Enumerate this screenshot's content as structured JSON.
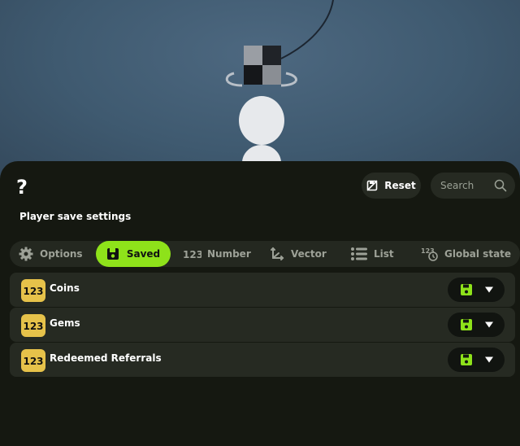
{
  "header": {
    "help_glyph": "?",
    "reset_label": "Reset",
    "search_placeholder": "Search"
  },
  "title": "Player save settings",
  "tabs": [
    {
      "label": "Options",
      "icon": "gear-icon",
      "active": false
    },
    {
      "label": "Saved",
      "icon": "save-icon",
      "active": true
    },
    {
      "label": "Number",
      "icon": "number-123-icon",
      "active": false
    },
    {
      "label": "Vector",
      "icon": "vector-axes-icon",
      "active": false
    },
    {
      "label": "List",
      "icon": "list-icon",
      "active": false
    },
    {
      "label": "Global state",
      "icon": "global-state-icon",
      "active": false
    }
  ],
  "rows": [
    {
      "label": "Coins",
      "type_icon": "number-123-icon"
    },
    {
      "label": "Gems",
      "type_icon": "number-123-icon"
    },
    {
      "label": "Redeemed Referrals",
      "type_icon": "number-123-icon"
    }
  ],
  "colors": {
    "accent": "#8ee21a",
    "panel": "#151811",
    "badge": "#e6c24a",
    "scene_background": "#3f5a70"
  }
}
